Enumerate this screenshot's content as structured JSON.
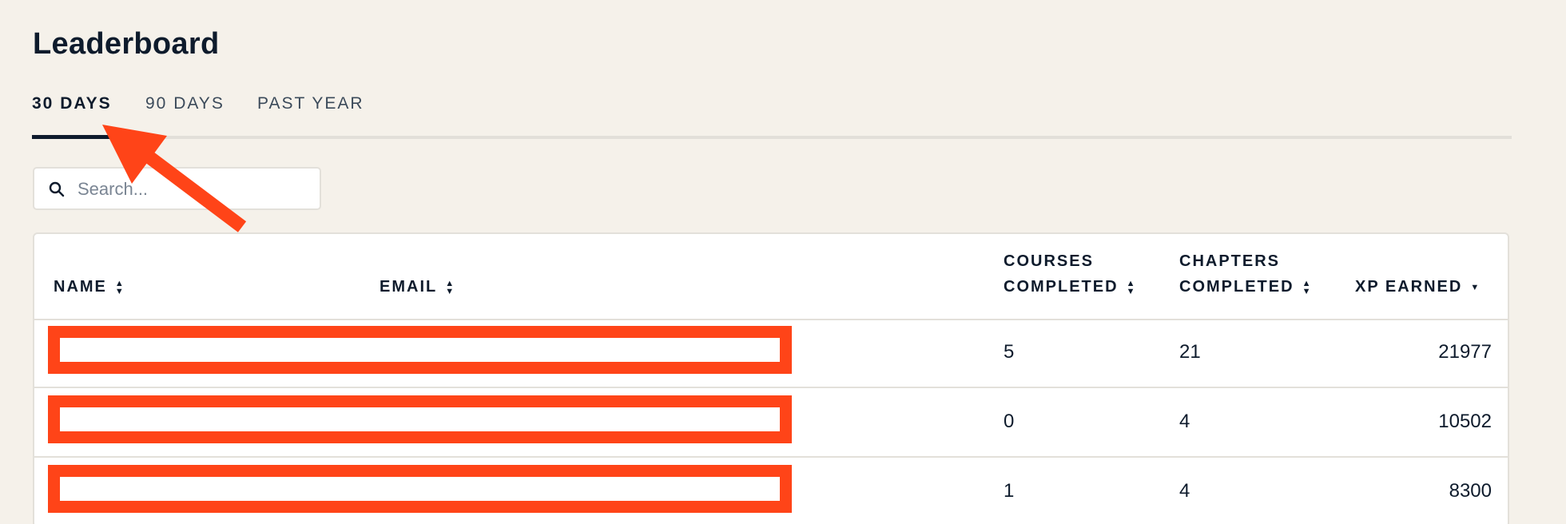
{
  "page": {
    "title": "Leaderboard"
  },
  "tabs": [
    {
      "label": "30 DAYS",
      "active": true
    },
    {
      "label": "90 DAYS",
      "active": false
    },
    {
      "label": "PAST YEAR",
      "active": false
    }
  ],
  "search": {
    "placeholder": "Search...",
    "icon": "search-icon"
  },
  "table": {
    "columns": {
      "name": "NAME",
      "email": "EMAIL",
      "courses_line1": "COURSES",
      "courses_line2": "COMPLETED",
      "chapters_line1": "CHAPTERS",
      "chapters_line2": "COMPLETED",
      "xp": "XP EARNED"
    },
    "sorted_column": "xp",
    "sort_direction": "descending",
    "rows": [
      {
        "courses_completed": "5",
        "chapters_completed": "21",
        "xp_earned": "21977",
        "name_email_redacted": true
      },
      {
        "courses_completed": "0",
        "chapters_completed": "4",
        "xp_earned": "10502",
        "name_email_redacted": true
      },
      {
        "courses_completed": "1",
        "chapters_completed": "4",
        "xp_earned": "8300",
        "name_email_redacted": true
      }
    ]
  },
  "colors": {
    "background": "#f5f1ea",
    "text": "#0e1b2c",
    "annotation": "#ff4418",
    "border": "#e3e0da"
  }
}
